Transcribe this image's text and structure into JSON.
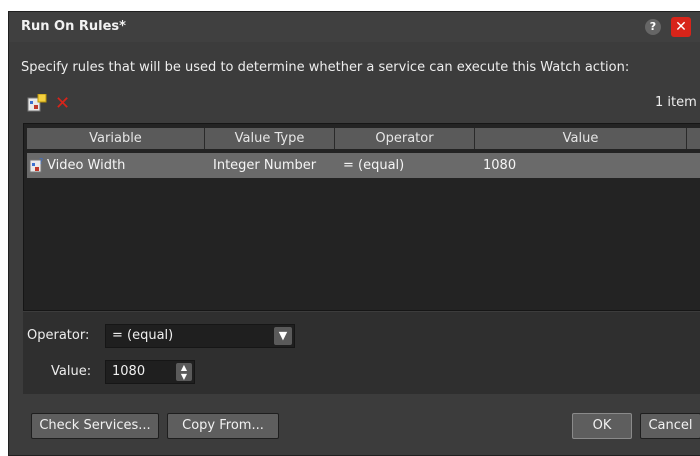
{
  "window": {
    "title": "Run On Rules*",
    "help_label": "?",
    "close_label": "✕"
  },
  "instructions": "Specify rules that will be used to determine whether a service can execute this Watch action:",
  "toolbar": {
    "add_icon": "add-rule-icon",
    "delete_icon": "delete-icon",
    "delete_glyph": "✕",
    "item_count": "1 item"
  },
  "grid": {
    "columns": [
      "Variable",
      "Value Type",
      "Operator",
      "Value"
    ],
    "rows": [
      {
        "variable": "Video Width",
        "value_type": "Integer Number",
        "operator": "= (equal)",
        "value": "1080"
      }
    ]
  },
  "editor": {
    "operator_label": "Operator:",
    "operator_value": "= (equal)",
    "value_label": "Value:",
    "value_value": "1080"
  },
  "buttons": {
    "check_services": "Check Services...",
    "copy_from": "Copy From...",
    "ok": "OK",
    "cancel": "Cancel"
  },
  "colors": {
    "dialog_bg": "#3c3c3c",
    "grid_bg": "#232323",
    "selected_row": "#6a6a6a",
    "close_red": "#d8241a"
  }
}
